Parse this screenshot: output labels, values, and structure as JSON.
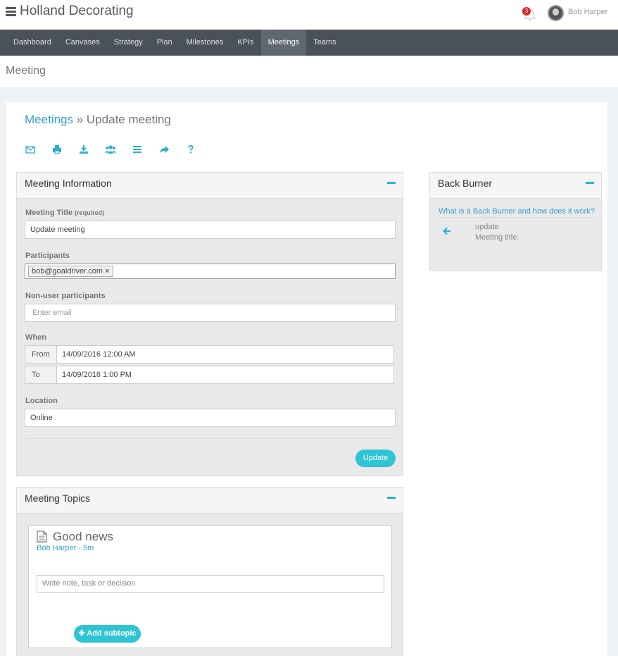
{
  "app": {
    "company": "Holland Decorating",
    "notification_count": "3",
    "user_name": "Bob Harper"
  },
  "nav": {
    "items": [
      "Dashboard",
      "Canvases",
      "Strategy",
      "Plan",
      "Milestones",
      "KPIs",
      "Meetings",
      "Teams"
    ],
    "active": "Meetings"
  },
  "page": {
    "title": "Meeting"
  },
  "breadcrumb": {
    "parent": "Meetings",
    "separator": "»",
    "current": "Update meeting"
  },
  "toolbar": {
    "icons": [
      "email-icon",
      "print-icon",
      "download-icon",
      "participants-icon",
      "list-icon",
      "share-icon",
      "help-icon"
    ]
  },
  "meeting_info": {
    "title": "Meeting Information",
    "meeting_title_label": "Meeting Title",
    "required_note": "(required)",
    "meeting_title_value": "Update meeting",
    "participants_label": "Participants",
    "participant_tag": "bob@goaldriver.com",
    "non_user_label": "Non-user participants",
    "non_user_placeholder": "Enter email",
    "when_label": "When",
    "from_label": "From",
    "from_value": "14/09/2016 12:00 AM",
    "to_label": "To",
    "to_value": "14/09/2016 1:00 PM",
    "location_label": "Location",
    "location_value": "Online",
    "update_button": "Update"
  },
  "back_burner": {
    "title": "Back Burner",
    "help_link": "What is a Back Burner and how does it work?",
    "item_text": "update",
    "item_meta": "Meeting title:"
  },
  "topics": {
    "title": "Meeting Topics",
    "topic_title": "Good news",
    "topic_meta": "Bob Harper - 5m",
    "note_placeholder": "Write note, task or decision",
    "add_subtopic": "Add subtopic"
  },
  "colors": {
    "accent": "#2ec4d3",
    "link": "#32a3c8",
    "nav_bg": "#4a5159",
    "badge": "#e02424"
  }
}
